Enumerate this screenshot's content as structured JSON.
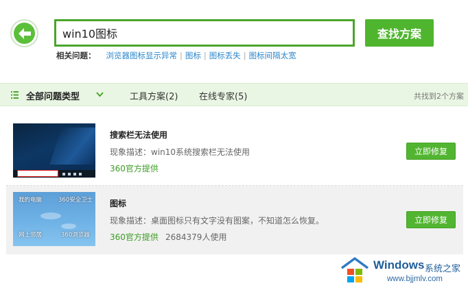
{
  "search": {
    "query": "win10图标",
    "button_label": "查找方案"
  },
  "related": {
    "label": "相关问题：",
    "links": [
      "浏览器图标显示异常",
      "图标",
      "图标丢失",
      "图标间隔太宽"
    ],
    "separator": "|"
  },
  "filter": {
    "all_types": "全部问题类型",
    "tabs": [
      "工具方案(2)",
      "在线专家(5)"
    ],
    "count_text": "共找到2个方案"
  },
  "results": [
    {
      "title": "搜索栏无法使用",
      "description": "现象描述：win10系统搜索栏无法使用",
      "provider": "360官方提供",
      "usage": "",
      "fix_label": "立即修复"
    },
    {
      "title": "图标",
      "description": "现象描述：桌面图标只有文字没有图案，不知道怎么恢复。",
      "provider": "360官方提供",
      "usage": "2684379人使用",
      "fix_label": "立即修复",
      "thumbnail_labels": [
        "我的电脑",
        "360安全卫士",
        "网上邻居",
        "360浏览器"
      ]
    }
  ],
  "watermark": {
    "brand": "Windows",
    "brand_cn": "系统之家",
    "site": "www.bjjmlv.com"
  },
  "colors": {
    "accent_green": "#4fb52e",
    "link_blue": "#2b86c9",
    "filter_bg": "#eaf6e4",
    "provider_green": "#3c9c23"
  },
  "icons": [
    "back-arrow-icon",
    "list-icon",
    "chevron-down-icon",
    "windows-logo-icon"
  ]
}
